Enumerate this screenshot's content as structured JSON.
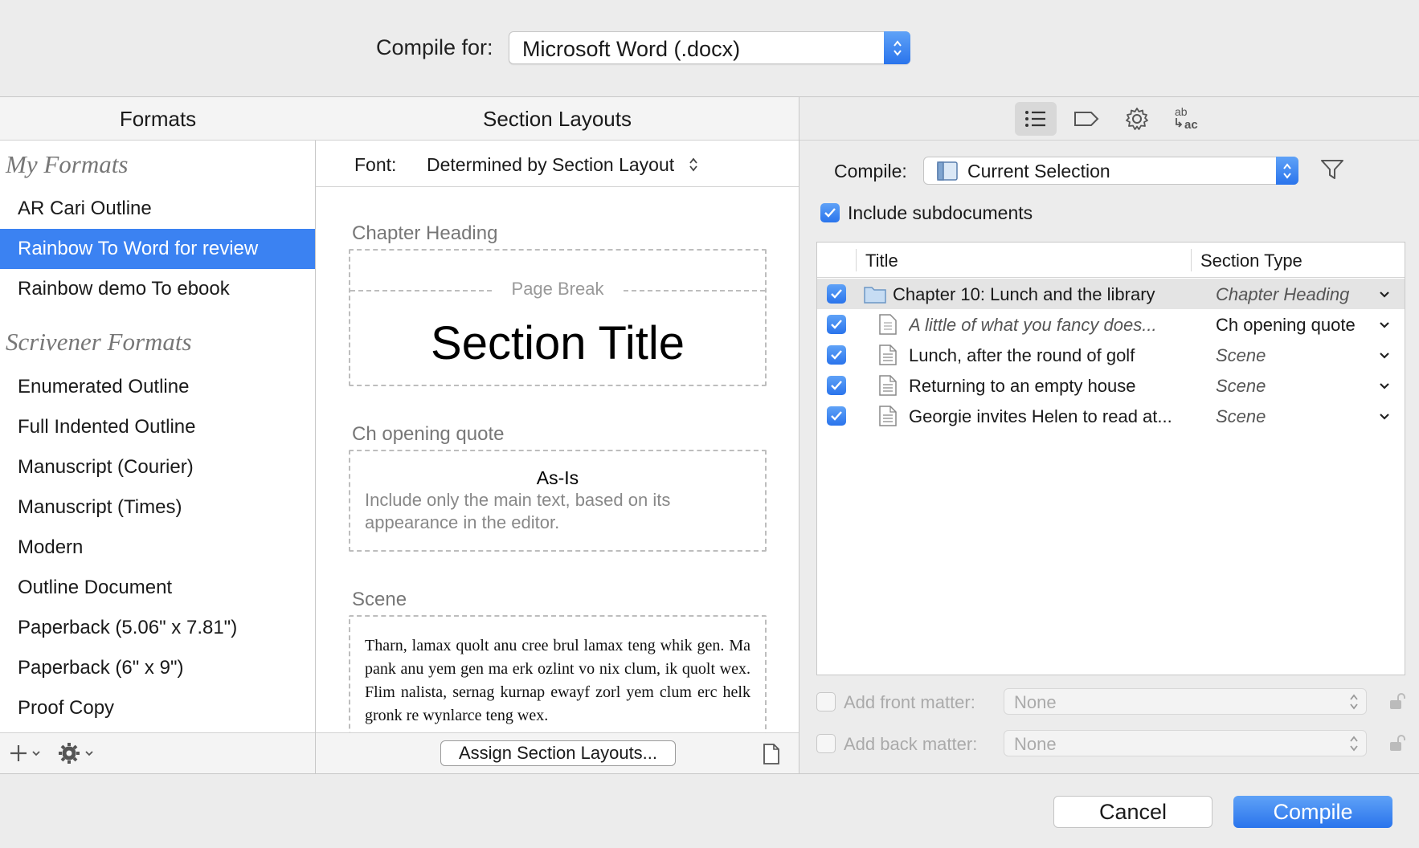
{
  "compile_for": {
    "label": "Compile for:",
    "value": "Microsoft Word (.docx)"
  },
  "formats": {
    "header": "Formats",
    "my_formats_title": "My Formats",
    "my_formats": [
      "AR Cari Outline",
      "Rainbow To Word for review",
      "Rainbow demo To ebook"
    ],
    "selected": "Rainbow To Word for review",
    "scrivener_formats_title": "Scrivener Formats",
    "scrivener_formats": [
      "Enumerated Outline",
      "Full Indented Outline",
      "Manuscript (Courier)",
      "Manuscript (Times)",
      "Modern",
      "Outline Document",
      "Paperback (5.06\" x 7.81\")",
      "Paperback (6\" x 9\")",
      "Proof Copy"
    ]
  },
  "section_layouts": {
    "header": "Section Layouts",
    "font_label": "Font:",
    "font_value": "Determined by Section Layout",
    "layouts": [
      {
        "label": "Chapter Heading",
        "page_break": "Page Break",
        "title": "Section Title"
      },
      {
        "label": "Ch opening quote",
        "title": "As-Is",
        "description": "Include only the main text, based on its appearance in the editor."
      },
      {
        "label": "Scene",
        "sample_text": "Tharn, lamax quolt anu cree brul lamax teng whik gen. Ma pank anu yem gen ma erk ozlint vo nix clum, ik quolt wex. Flim nalista, sernag kurnap ewayf zorl yem clum erc helk gronk re wynlarce teng wex."
      }
    ],
    "assign_button": "Assign Section Layouts..."
  },
  "contents": {
    "compile_label": "Compile:",
    "compile_value": "Current Selection",
    "include_subdocuments": "Include subdocuments",
    "include_subdocuments_checked": true,
    "columns": {
      "title": "Title",
      "section_type": "Section Type"
    },
    "rows": [
      {
        "title": "Chapter 10: Lunch and the library",
        "type": "Chapter Heading",
        "checked": true,
        "icon": "folder-icon",
        "italic_title": false
      },
      {
        "title": "A little of what you fancy does...",
        "type": "Ch opening quote",
        "checked": true,
        "icon": "document-icon",
        "italic_title": true
      },
      {
        "title": "Lunch, after the round of golf",
        "type": "Scene",
        "checked": true,
        "icon": "document-text-icon",
        "italic_title": false
      },
      {
        "title": "Returning to an empty house",
        "type": "Scene",
        "checked": true,
        "icon": "document-text-icon",
        "italic_title": false
      },
      {
        "title": "Georgie invites Helen to read at...",
        "type": "Scene",
        "checked": true,
        "icon": "document-text-icon",
        "italic_title": false
      }
    ],
    "front_matter_label": "Add front matter:",
    "front_matter_value": "None",
    "back_matter_label": "Add back matter:",
    "back_matter_value": "None"
  },
  "buttons": {
    "cancel": "Cancel",
    "compile": "Compile"
  },
  "colors": {
    "accent": "#3b82f2",
    "panel_bg": "#ececec"
  }
}
